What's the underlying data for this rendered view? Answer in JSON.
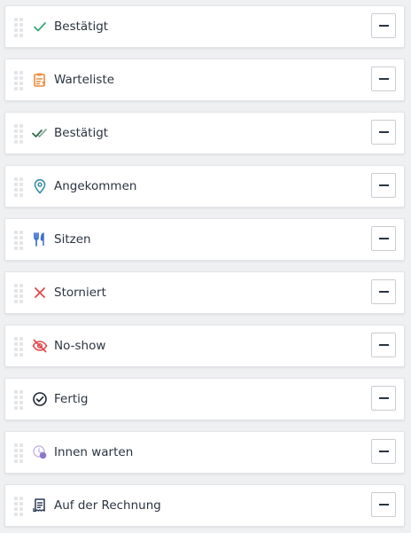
{
  "status_rows": [
    {
      "label": "Bestätigt",
      "icon": "checkmark-icon",
      "icon_color": "#3aa57c"
    },
    {
      "label": "Warteliste",
      "icon": "clipboard-list-icon",
      "icon_color": "#f08b3c"
    },
    {
      "label": "Bestätigt",
      "icon": "double-checkmark-icon",
      "icon_color": "#2f6b4e"
    },
    {
      "label": "Angekommen",
      "icon": "location-pin-icon",
      "icon_color": "#3b8fa8"
    },
    {
      "label": "Sitzen",
      "icon": "fork-knife-icon",
      "icon_color": "#3f6fd0"
    },
    {
      "label": "Storniert",
      "icon": "cross-icon",
      "icon_color": "#e0484a"
    },
    {
      "label": "No-show",
      "icon": "eye-slash-icon",
      "icon_color": "#e0484a"
    },
    {
      "label": "Fertig",
      "icon": "check-circle-icon",
      "icon_color": "#1f2733"
    },
    {
      "label": "Innen warten",
      "icon": "waiting-inside-icon",
      "icon_color": "#8e78c8"
    },
    {
      "label": "Auf der Rechnung",
      "icon": "receipt-icon",
      "icon_color": "#2b3a55"
    }
  ],
  "colors": {
    "background": "#eff0f2",
    "card": "#ffffff",
    "text": "#2b3440"
  }
}
